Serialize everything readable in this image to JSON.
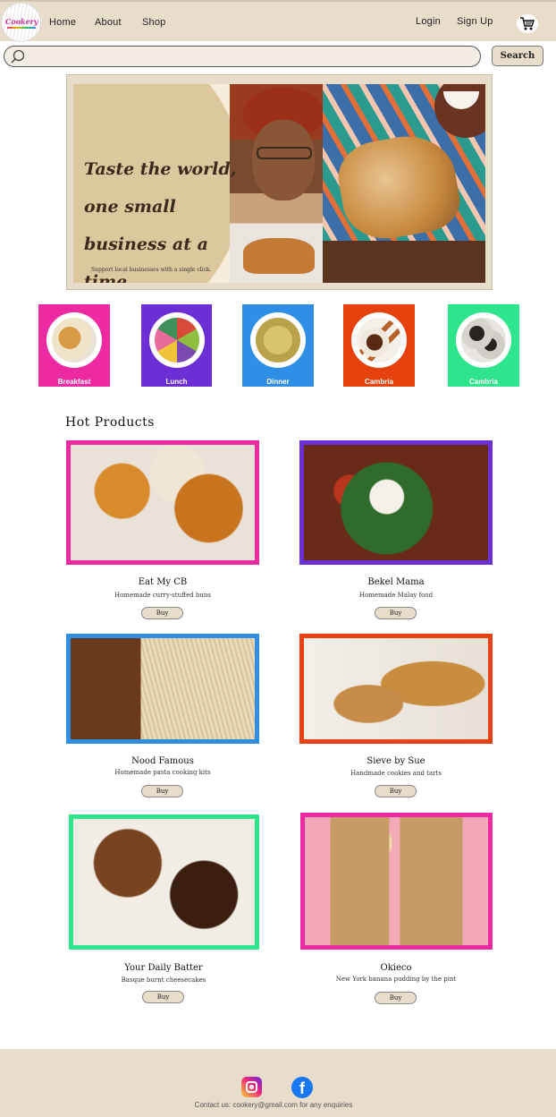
{
  "nav": {
    "logo_text": "Cookery",
    "links": [
      "Home",
      "About",
      "Shop"
    ],
    "login": "Login",
    "signup": "Sign Up",
    "cart_icon": "cart-icon"
  },
  "search": {
    "placeholder": "",
    "button": "Search",
    "icon": "search-icon"
  },
  "hero": {
    "title_line1": "Taste the world,",
    "title_line2": "one small",
    "title_line3": "business at a time",
    "subtitle": "Support local businesses with a single click."
  },
  "categories": [
    {
      "label": "Breakfast",
      "color": "#ee2aa2"
    },
    {
      "label": "Lunch",
      "color": "#6c2fd6"
    },
    {
      "label": "Dinner",
      "color": "#2f8fe6"
    },
    {
      "label": "Cambria",
      "color": "#e6420e"
    },
    {
      "label": "Cambria",
      "color": "#2ee58c"
    }
  ],
  "hot_products": {
    "title": "Hot Products",
    "items": [
      {
        "name": "Eat My CB",
        "desc": "Homemade curry-stuffed buns",
        "buy": "Buy",
        "border": "#ee2aa2"
      },
      {
        "name": "Bekel Mama",
        "desc": "Homemade Malay food",
        "buy": "Buy",
        "border": "#6c2fd6"
      },
      {
        "name": "Nood Famous",
        "desc": "Homemade pasta cooking kits",
        "buy": "Buy",
        "border": "#2f8fe6"
      },
      {
        "name": "Sieve by Sue",
        "desc": "Handmade cookies and tarts",
        "buy": "Buy",
        "border": "#e6420e"
      },
      {
        "name": "Your Daily Batter",
        "desc": "Basque burnt cheesecakes",
        "buy": "Buy",
        "border": "#2ee58c"
      },
      {
        "name": "Okieco",
        "desc": "New York banana pudding by the pint",
        "buy": "Buy",
        "border": "#ee2aa2"
      }
    ]
  },
  "footer": {
    "contact": "Contact us:  cookery@gmail.com for any enquiries",
    "icons": [
      "instagram-icon",
      "facebook-icon"
    ],
    "facebook_glyph": "f"
  }
}
